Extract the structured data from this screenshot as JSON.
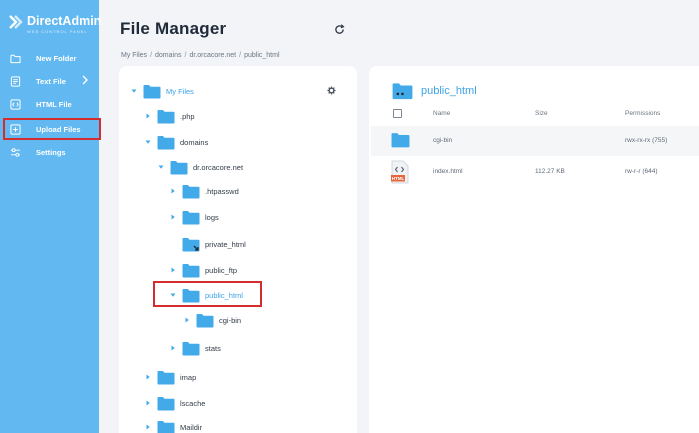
{
  "brand": {
    "name": "DirectAdmin",
    "tagline": "WEB CONTROL PANEL"
  },
  "sidebar": {
    "items": [
      {
        "label": "New Folder",
        "icon": "folder-icon"
      },
      {
        "label": "Text File",
        "icon": "text-file-icon"
      },
      {
        "label": "HTML File",
        "icon": "code-icon"
      },
      {
        "label": "Upload Files",
        "icon": "upload-plus-icon"
      },
      {
        "label": "Settings",
        "icon": "sliders-icon"
      }
    ]
  },
  "header": {
    "title": "File Manager"
  },
  "breadcrumb": [
    "My Files",
    "domains",
    "dr.orcacore.net",
    "public_html"
  ],
  "tree": {
    "root": "My Files",
    "nodes": {
      "php": ".php",
      "domains": "domains",
      "orcacore": "dr.orcacore.net",
      "htpasswd": ".htpasswd",
      "logs": "logs",
      "private_html": "private_html",
      "public_ftp": "public_ftp",
      "public_html": "public_html",
      "cgi_bin": "cgi-bin",
      "stats": "stats",
      "imap": "imap",
      "lscache": "lscache",
      "maildir": "Maildir"
    }
  },
  "detail": {
    "folder": "public_html",
    "columns": {
      "name": "Name",
      "size": "Size",
      "permissions": "Permissions"
    },
    "rows": [
      {
        "name": "cgi-bin",
        "size": "",
        "permissions": "rwx-rx-rx (755)"
      },
      {
        "name": "index.html",
        "size": "112.27 KB",
        "permissions": "rw-r-r (644)",
        "badge": "HTML"
      }
    ]
  },
  "colors": {
    "sidebar": "#62b8f0",
    "accent": "#3da2e6",
    "folder": "#43aaea",
    "highlight": "#d42d2d",
    "file_badge": "#e8663c"
  }
}
